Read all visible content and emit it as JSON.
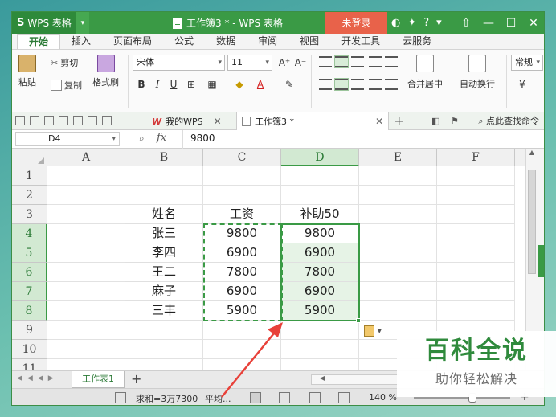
{
  "app": {
    "name": "WPS 表格",
    "logo": "S",
    "document_title": "工作簿3 * - WPS 表格",
    "login_label": "未登录",
    "help_label": "?"
  },
  "menu_tabs": [
    "开始",
    "插入",
    "页面布局",
    "公式",
    "数据",
    "审阅",
    "视图",
    "开发工具",
    "云服务"
  ],
  "ribbon": {
    "paste": "粘贴",
    "cut": "剪切",
    "copy": "复制",
    "format_painter": "格式刷",
    "font_name": "宋体",
    "font_size": "11",
    "bold": "B",
    "italic": "I",
    "underline": "U",
    "merge_center": "合并居中",
    "auto_wrap": "自动换行",
    "number_format": "常规"
  },
  "tabs": {
    "my_wps": "我的WPS",
    "workbook": "工作簿3 *",
    "search_command": "点此查找命令"
  },
  "formula_bar": {
    "cell_ref": "D4",
    "fx": "fx",
    "value": "9800"
  },
  "grid": {
    "columns": [
      "A",
      "B",
      "C",
      "D",
      "E",
      "F"
    ],
    "rows": [
      "1",
      "2",
      "3",
      "4",
      "5",
      "6",
      "7",
      "8",
      "9",
      "10",
      "11"
    ],
    "header_row": [
      "姓名",
      "工资",
      "补助50"
    ],
    "data": [
      [
        "张三",
        "9800",
        "9800"
      ],
      [
        "李四",
        "6900",
        "6900"
      ],
      [
        "王二",
        "7800",
        "7800"
      ],
      [
        "麻子",
        "6900",
        "6900"
      ],
      [
        "三丰",
        "5900",
        "5900"
      ]
    ]
  },
  "sheet": {
    "tab_name": "工作表1",
    "add": "+"
  },
  "status": {
    "sum": "求和=3万7300",
    "avg": "平均...",
    "zoom": "140 %",
    "zoom_plus": "+"
  },
  "watermark": {
    "title": "百科全说",
    "subtitle": "助你轻松解决"
  },
  "colors": {
    "title_green": "#3a9a45",
    "login_red": "#e8624a",
    "selection_green": "#3a9a45",
    "arrow_red": "#e8413a"
  }
}
